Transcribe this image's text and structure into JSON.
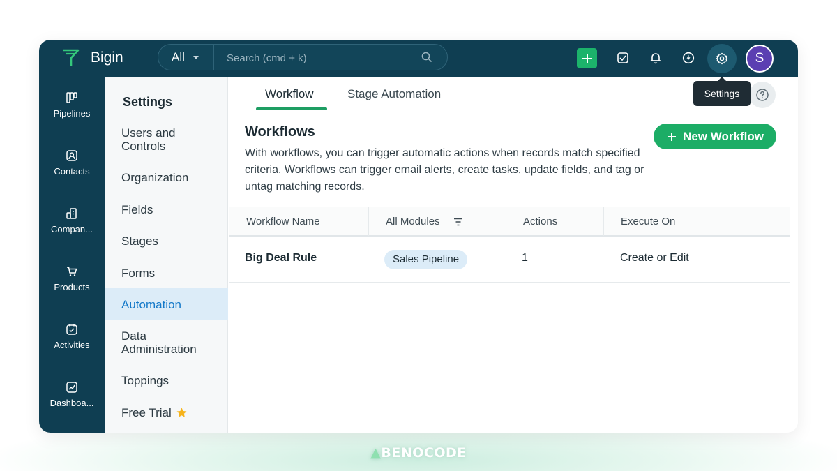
{
  "app": {
    "name": "Bigin"
  },
  "topbar": {
    "scope": "All",
    "search_placeholder": "Search (cmd + k)",
    "avatar_initial": "S",
    "icons": [
      "add-icon",
      "tasks-icon",
      "bell-icon",
      "zap-icon",
      "gear-icon"
    ]
  },
  "rail": {
    "items": [
      {
        "label": "Pipelines",
        "icon": "pipeline-icon"
      },
      {
        "label": "Contacts",
        "icon": "contact-icon"
      },
      {
        "label": "Compan...",
        "icon": "company-icon"
      },
      {
        "label": "Products",
        "icon": "cart-icon"
      },
      {
        "label": "Activities",
        "icon": "calendar-check-icon"
      },
      {
        "label": "Dashboa...",
        "icon": "chart-icon"
      }
    ]
  },
  "settings": {
    "title": "Settings",
    "items": [
      {
        "label": "Users and Controls"
      },
      {
        "label": "Organization"
      },
      {
        "label": "Fields"
      },
      {
        "label": "Stages"
      },
      {
        "label": "Forms"
      },
      {
        "label": "Automation",
        "active": true
      },
      {
        "label": "Data Administration"
      },
      {
        "label": "Toppings"
      },
      {
        "label": "Free Trial"
      }
    ]
  },
  "tabs": [
    {
      "label": "Workflow",
      "active": true
    },
    {
      "label": "Stage Automation"
    }
  ],
  "tooltip": "Settings",
  "workflows": {
    "title": "Workflows",
    "description": "With workflows, you can trigger automatic actions when records match specified criteria. Workflows can trigger email alerts, create tasks, update fields, and tag or untag matching records.",
    "new_button": "New Workflow",
    "columns": [
      "Workflow Name",
      "All Modules",
      "Actions",
      "Execute On"
    ],
    "rows": [
      {
        "name": "Big Deal Rule",
        "module": "Sales Pipeline",
        "actions": "1",
        "execute_on": "Create or Edit"
      }
    ]
  },
  "watermark": "BENOCODE",
  "colors": {
    "topbar": "#0f3e52",
    "accent_green": "#1cad66",
    "active_blue": "#1479c9",
    "avatar": "#5b3fb2"
  }
}
